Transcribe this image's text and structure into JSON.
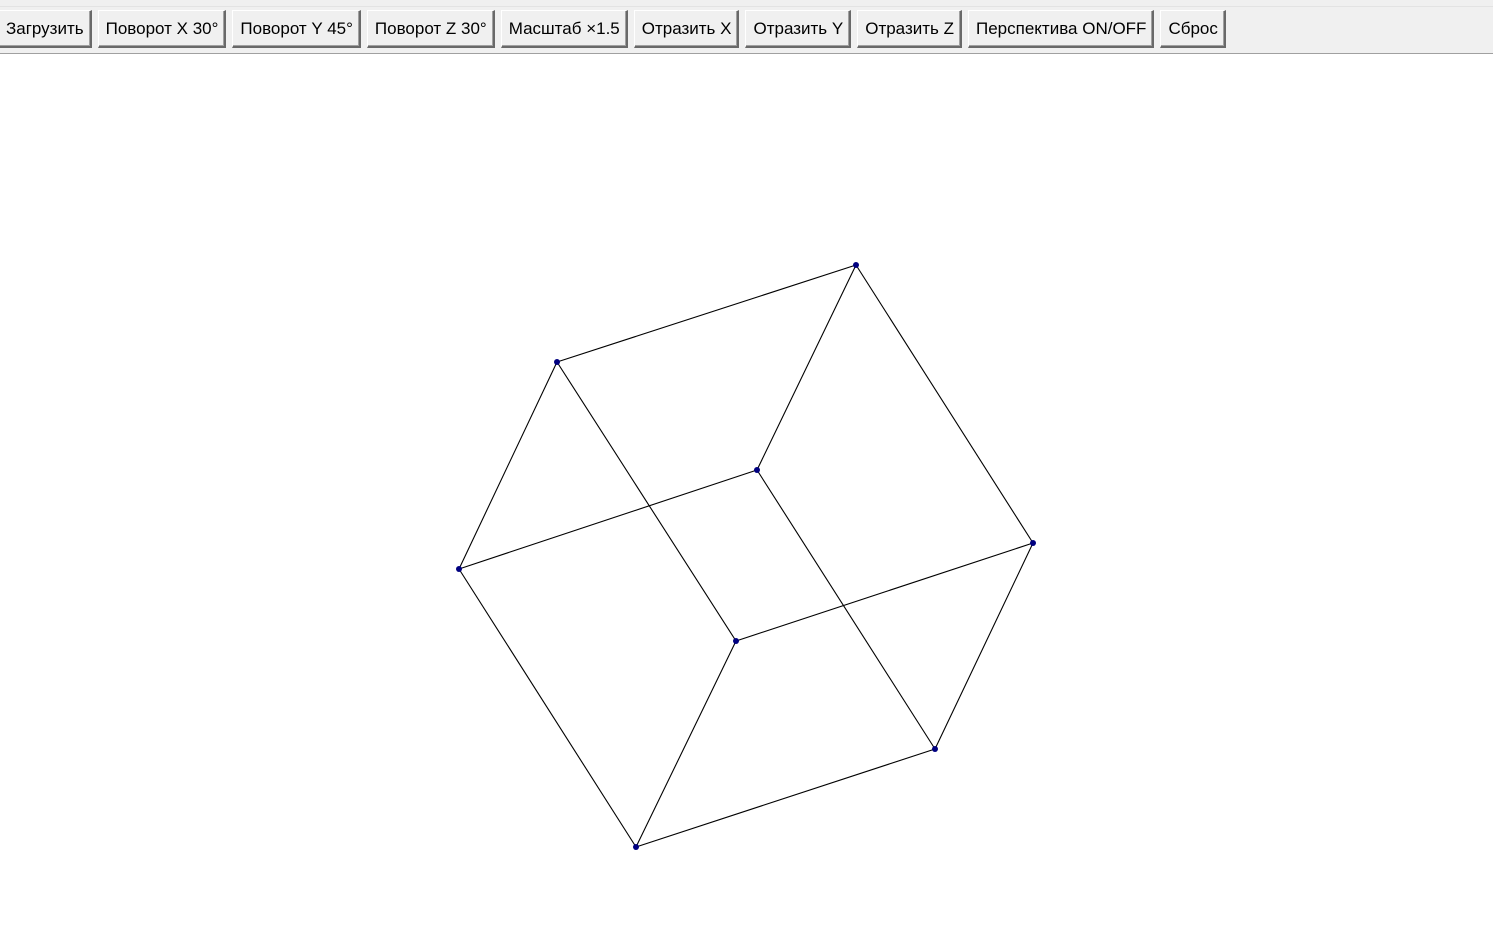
{
  "toolbar": {
    "buttons": [
      {
        "id": "load",
        "label": "Загрузить"
      },
      {
        "id": "rot-x",
        "label": "Поворот X 30°"
      },
      {
        "id": "rot-y",
        "label": "Поворот Y 45°"
      },
      {
        "id": "rot-z",
        "label": "Поворот Z 30°"
      },
      {
        "id": "scale",
        "label": "Масштаб ×1.5"
      },
      {
        "id": "mirror-x",
        "label": "Отразить X"
      },
      {
        "id": "mirror-y",
        "label": "Отразить Y"
      },
      {
        "id": "mirror-z",
        "label": "Отразить Z"
      },
      {
        "id": "perspective",
        "label": "Перспектива ON/OFF"
      },
      {
        "id": "reset",
        "label": "Сброс"
      }
    ]
  },
  "scene": {
    "edge_color": "#000000",
    "vertex_color": "#000080"
  }
}
